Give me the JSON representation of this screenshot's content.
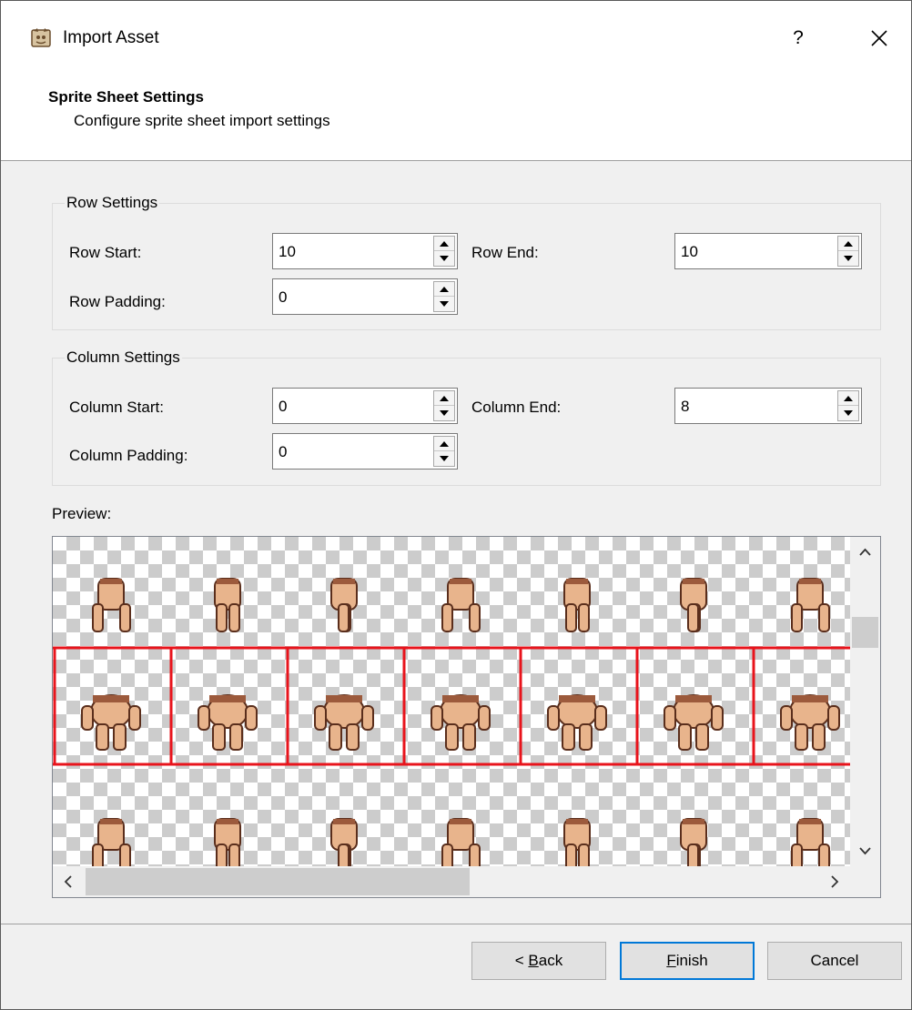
{
  "window": {
    "title": "Import Asset",
    "help_label": "?",
    "icons": {
      "app": "app-icon",
      "close": "close-icon"
    }
  },
  "header": {
    "title": "Sprite Sheet Settings",
    "subtitle": "Configure sprite sheet import settings"
  },
  "row_settings": {
    "group_title": "Row Settings",
    "start_label": "Row Start:",
    "start_value": "10",
    "end_label": "Row End:",
    "end_value": "10",
    "padding_label": "Row Padding:",
    "padding_value": "0"
  },
  "column_settings": {
    "group_title": "Column Settings",
    "start_label": "Column Start:",
    "start_value": "0",
    "end_label": "Column End:",
    "end_value": "8",
    "padding_label": "Column Padding:",
    "padding_value": "0"
  },
  "preview": {
    "label": "Preview:",
    "visible_columns": 7,
    "visible_rows": 3,
    "highlighted_row": 1,
    "highlight_color": "#e8141c",
    "skin_color": "#e8b48c",
    "shadow_color": "#9c5a3c"
  },
  "buttons": {
    "back_prefix": "< ",
    "back_ul": "B",
    "back_rest": "ack",
    "finish_ul": "F",
    "finish_rest": "inish",
    "cancel": "Cancel"
  },
  "colors": {
    "accent": "#0078d7",
    "window_bg": "#f0f0f0"
  }
}
